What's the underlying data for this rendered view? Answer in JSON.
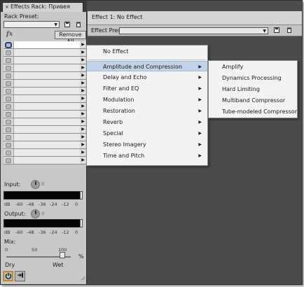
{
  "rack": {
    "tab_label": "Effects Rack: Привея",
    "tab_close": "×",
    "preset_label": "Rack Preset:",
    "fx_label": "fx",
    "remove_all": "Remove All",
    "slot_count": 16,
    "input_label": "Input:",
    "input_value": "0",
    "output_label": "Output:",
    "output_value": "0",
    "meter_scale": [
      "dB",
      "-60",
      "-48",
      "-36",
      "-24",
      "-12",
      "0"
    ],
    "mix_label": "Mix:",
    "mix_scale": [
      "0",
      "50",
      "100"
    ],
    "mix_percent": "%",
    "mix_value_percent": 100,
    "mix_dry": "Dry",
    "mix_wet": "Wet"
  },
  "effect_window": {
    "title": "Effect 1: No Effect",
    "preset_label": "Effect Preset:"
  },
  "menu": {
    "no_effect": "No Effect",
    "items": [
      "Amplitude and Compression",
      "Delay and Echo",
      "Filter and EQ",
      "Modulation",
      "Restoration",
      "Reverb",
      "Special",
      "Stereo Imagery",
      "Time and Pitch"
    ],
    "highlighted_index": 0
  },
  "submenu": {
    "items": [
      "Amplify",
      "Dynamics Processing",
      "Hard Limiting",
      "Multiband Compressor",
      "Tube-modeled Compressor"
    ]
  },
  "icons": {
    "rack_save": "save-icon",
    "rack_delete": "trash-icon",
    "effect_save": "save-icon",
    "effect_delete": "trash-icon",
    "power_toggle": "power-icon",
    "apply": "apply-icon",
    "resize": "resize-grip-icon"
  },
  "colors": {
    "menu_highlight": "#c3d3e7",
    "bottom_button_highlight": "#c08a2a",
    "panel_background": "#4a4a4a"
  }
}
